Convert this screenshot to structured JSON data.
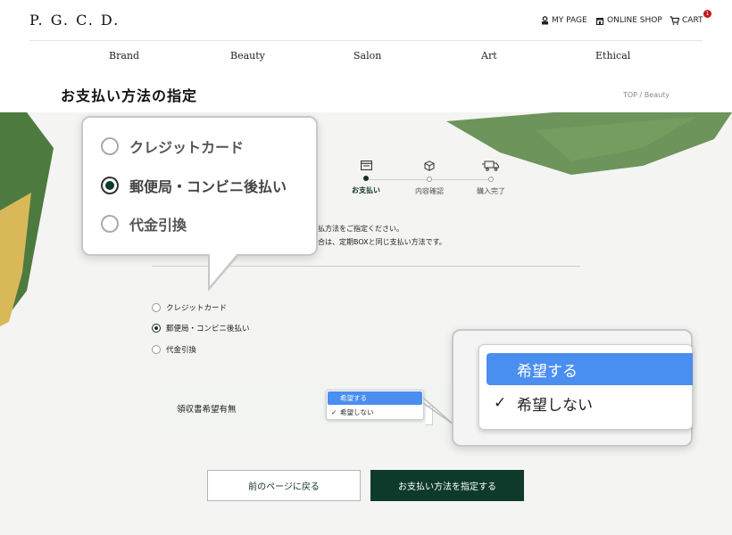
{
  "header": {
    "logo": "P. G. C. D.",
    "my_page": "MY PAGE",
    "online_shop": "ONLINE SHOP",
    "cart": "CART",
    "cart_count": "1"
  },
  "nav": [
    "Brand",
    "Beauty",
    "Salon",
    "Art",
    "Ethical"
  ],
  "page": {
    "title": "お支払い方法の指定",
    "breadcrumb": "TOP  /  Beauty"
  },
  "steps": [
    {
      "label": "お支払い"
    },
    {
      "label": "内容確認"
    },
    {
      "label": "購入完了"
    }
  ],
  "instructions": {
    "line1": "お支払方法をご指定ください。",
    "line2": "の場合は、定期BOXと同じ支払い方法です。"
  },
  "payment_options": [
    {
      "label": "クレジットカード"
    },
    {
      "label": "郵便局・コンビニ後払い"
    },
    {
      "label": "代金引換"
    }
  ],
  "receipt": {
    "label": "領収書希望有無",
    "options": [
      "希望する",
      "希望しない"
    ]
  },
  "buttons": {
    "back": "前のページに戻る",
    "next": "お支払い方法を指定する"
  },
  "colors": {
    "brand_green": "#0e3a2c",
    "highlight_blue": "#4a8ef0",
    "badge_red": "#c0161c"
  }
}
